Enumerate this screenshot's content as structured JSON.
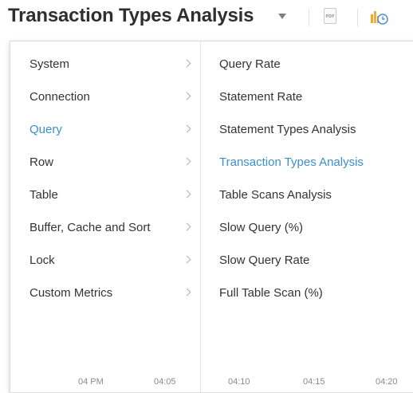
{
  "header": {
    "title": "Transaction Types Analysis",
    "pdf_icon_label": "PDF"
  },
  "menu": {
    "categories": [
      {
        "label": "System",
        "active": false
      },
      {
        "label": "Connection",
        "active": false
      },
      {
        "label": "Query",
        "active": true
      },
      {
        "label": "Row",
        "active": false
      },
      {
        "label": "Table",
        "active": false
      },
      {
        "label": "Buffer, Cache and Sort",
        "active": false
      },
      {
        "label": "Lock",
        "active": false
      },
      {
        "label": "Custom Metrics",
        "active": false
      }
    ],
    "submenu": [
      {
        "label": "Query Rate",
        "active": false
      },
      {
        "label": "Statement Rate",
        "active": false
      },
      {
        "label": "Statement Types Analysis",
        "active": false
      },
      {
        "label": "Transaction Types Analysis",
        "active": true
      },
      {
        "label": "Table Scans Analysis",
        "active": false
      },
      {
        "label": "Slow Query (%)",
        "active": false
      },
      {
        "label": "Slow Query Rate",
        "active": false
      },
      {
        "label": "Full Table Scan (%)",
        "active": false
      }
    ]
  },
  "axis": {
    "ticks": [
      "04 PM",
      "04:05",
      "04:10",
      "04:15",
      "04:20"
    ]
  },
  "colors": {
    "accent": "#3a8fcc",
    "text": "#333333"
  }
}
